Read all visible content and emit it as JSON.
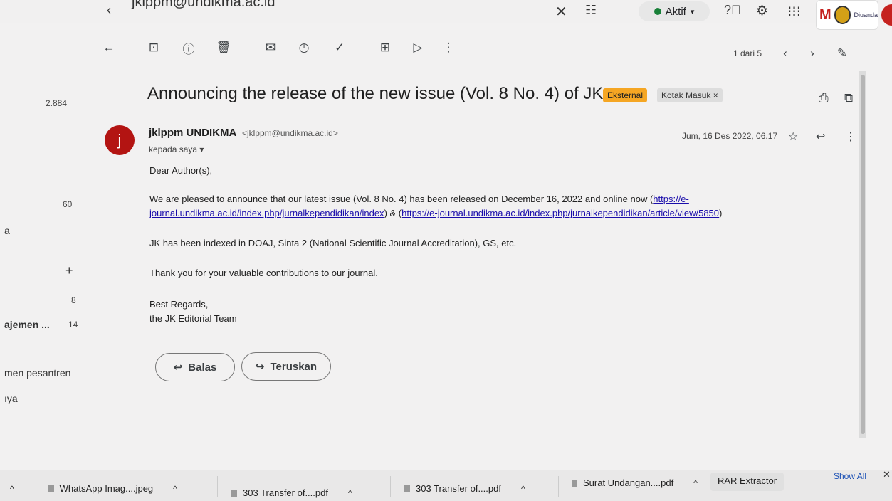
{
  "window": {
    "address_text": "jklppm@undikma.ac.id",
    "status_label": "Aktif",
    "account_org_text": "Diuanda"
  },
  "left_panel": {
    "counts": [
      "2.884",
      "60",
      "8",
      "14"
    ],
    "items": [
      "a",
      "ajemen ...",
      "men pesantren",
      "ıya"
    ],
    "plus_icon": "+"
  },
  "toolbar": {
    "pager": "1 dari 5"
  },
  "email": {
    "subject": "Announcing the release of the new issue (Vol. 8 No. 4) of JK",
    "label_external": "Eksternal",
    "label_inbox": "Kotak Masuk",
    "sender_initial": "j",
    "sender_name": "jklppm UNDIKMA",
    "sender_email": "<jklppm@undikma.ac.id>",
    "to_line": "kepada saya",
    "date": "Jum, 16 Des 2022, 06.17",
    "greeting": "Dear Author(s),",
    "para1_text": "We are pleased to announce that our latest issue  (Vol. 8 No. 4) has been released on December 16, 2022 and online now (",
    "link1": "https://e-journal.undikma.ac.id/index.php/jurnalkependidikan/index",
    "para1_mid": ") & (",
    "link2": "https://e-journal.undikma.ac.id/index.php/jurnalkependidikan/article/view/5850",
    "para1_end": ")",
    "para2": "JK has been indexed in DOAJ, Sinta 2 (National Scientific Journal Accreditation), GS, etc.",
    "para3": "Thank you for your valuable contributions to our journal.",
    "sign1": "Best Regards,",
    "sign2": "the JK Editorial Team",
    "reply_label": "Balas",
    "forward_label": "Teruskan"
  },
  "downloads": {
    "items": [
      "WhatsApp Imag....jpeg",
      "303 Transfer of....pdf",
      "303 Transfer of....pdf",
      "Surat Undangan....pdf"
    ],
    "rar_label": "RAR Extractor",
    "show_all": "Show All"
  }
}
